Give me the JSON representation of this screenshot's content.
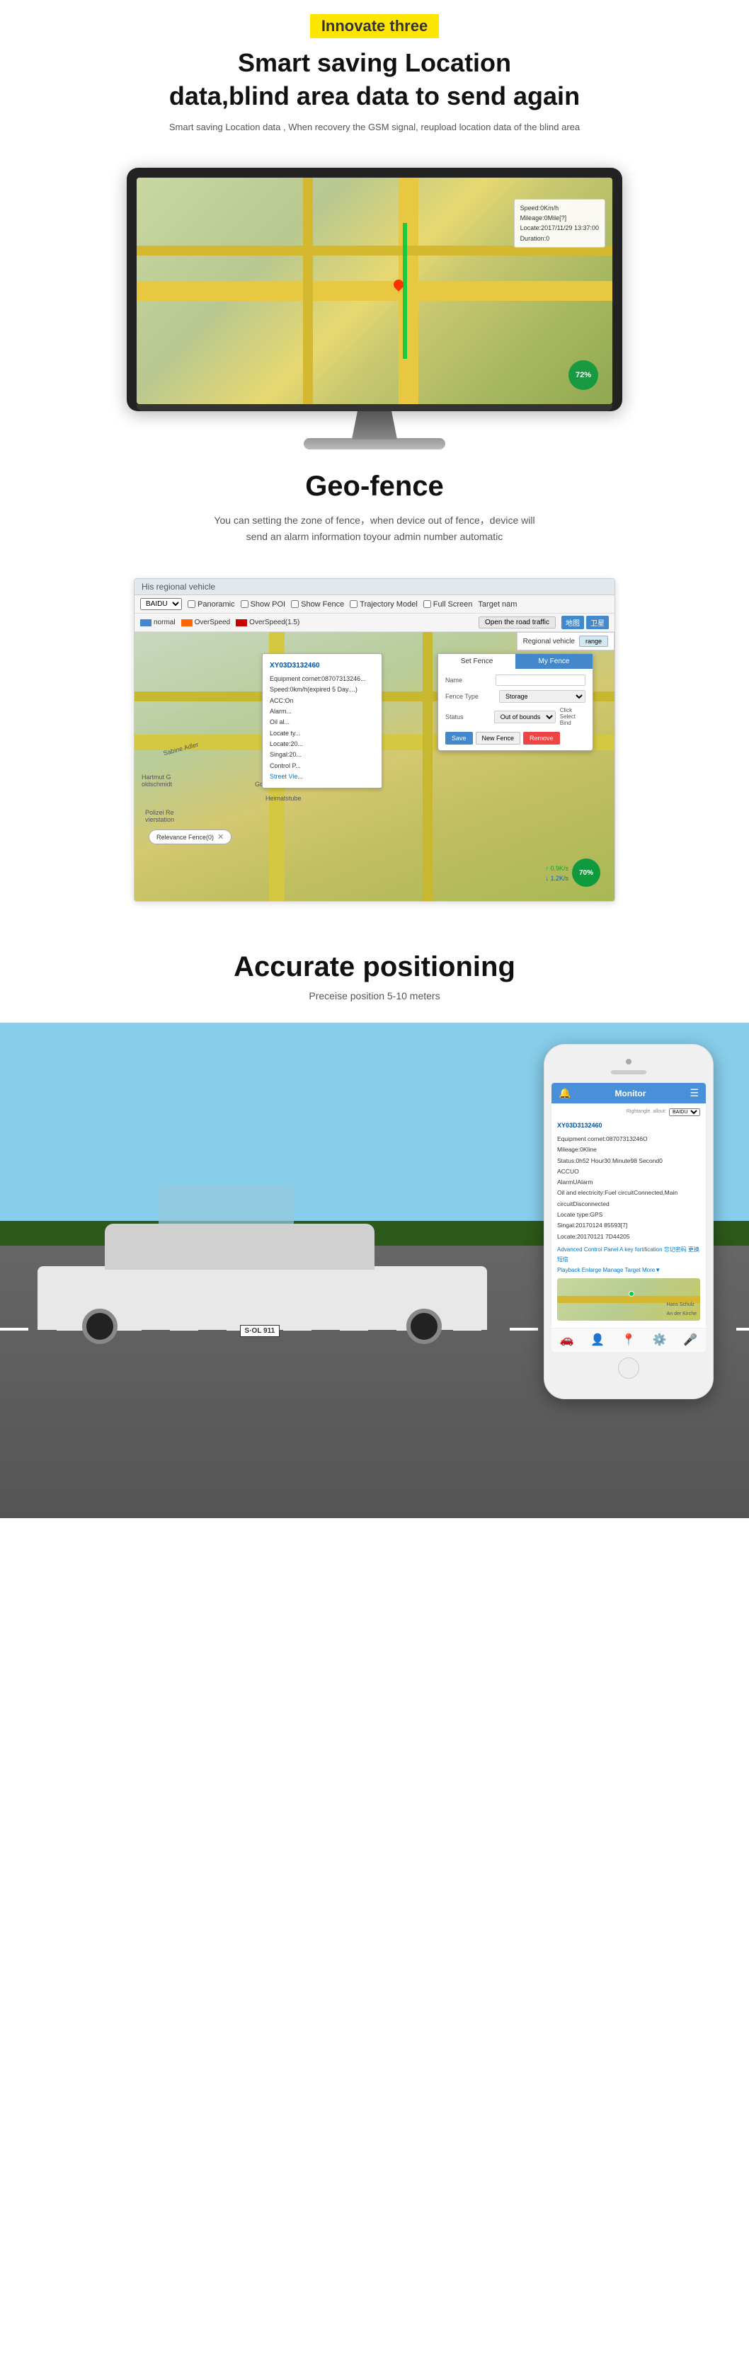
{
  "page": {
    "badge": "Innovate three",
    "sections": {
      "smart_saving": {
        "title_line1": "Smart saving Location",
        "title_line2": "data,blind area data to send again",
        "description": "Smart saving Location data , When recovery the GSM signal, reupload location data of the blind area"
      },
      "geofence": {
        "title": "Geo-fence",
        "description_line1": "You can setting the zone of fence，when device out of fence，device will",
        "description_line2": "send an alarm information toyour admin number automatic"
      },
      "accurate": {
        "title": "Accurate positioning",
        "description": "Preceise position 5-10 meters"
      }
    },
    "monitor_ui": {
      "speed_label": "Speed:0Km/h",
      "mileage_label": "Mileage:0Mile[?]",
      "locate_label": "Locate:2017/11/29 13:37:00",
      "duration_label": "Duration:0",
      "percent": "72%"
    },
    "geofence_ui": {
      "titlebar": "His regional vehicle",
      "baidu_option": "BAIDU",
      "toolbar_items": [
        "Panoramic",
        "Show POI",
        "Show Fence",
        "Trajectory Model",
        "Full Screen",
        "Target nam"
      ],
      "speed_normal": "normal",
      "speed_over": "OverSpeed",
      "speed_over15": "OverSpeed(1.5)",
      "open_road_btn": "Open the road traffic",
      "map_buttons": [
        "地图",
        "卫星"
      ],
      "regional_vehicle_label": "Regional vehicle",
      "range_btn": "range",
      "relevance_fence": "Relevance Fence(0)",
      "vehicle_popup": {
        "id": "XY03D3132460",
        "equipment": "Equipment cornet:08707313246...",
        "speed": "Speed:0km/h(expired 5 Day....)",
        "acc": "ACC:On",
        "alarm": "Alarm...",
        "oil": "Oil al...",
        "locate_type": "Locate ty...",
        "locate_pos": "Locate:20...",
        "signal": "Singal:20...",
        "control": "Control P...",
        "street": "Street Vie..."
      },
      "set_fence": {
        "tab1": "Set Fence",
        "tab2": "My Fence",
        "name_label": "Name",
        "fence_type_label": "Fence Type",
        "fence_type_value": "Storage",
        "status_label": "Status",
        "status_value": "Out of bounds",
        "click_select": "Click\nSelect Bind",
        "save_btn": "Save",
        "new_fence_btn": "New Fence",
        "remove_btn": "Remove"
      },
      "percent": "70%",
      "speed_down": "0.9K/s",
      "speed_up": "1.2K/s"
    },
    "phone_ui": {
      "titlebar": "Monitor",
      "device_id": "XY03D3132460",
      "right_label": "Rightangle",
      "baidu_label": "BAIDU",
      "fields": {
        "equipment": "Equipment cornet:08707313246O",
        "mileage": "Mileage:0Kline",
        "status": "Status:0h52 Hour30 Minute98 Second0",
        "acc": "ACCUO",
        "alarm": "AlarmUAlarm",
        "oil": "Oil and electricity:Fuel circuitConnected,Main circuitDisconnected",
        "locate_type": "Locate type:GPS",
        "signal": "Singal:20170124 85593[7]",
        "locate": "Locate:20170121 7D44205",
        "advanced": "Advanced  Control Panel  A key fortification  忘记密码  更换短信",
        "playback": "Playback  Enlarge  Manage Target  More▼"
      },
      "map_location": "An der Kirche",
      "map_person": "Hans Schulz",
      "nav_icons": [
        "car",
        "person",
        "location",
        "settings",
        "mic"
      ]
    }
  }
}
